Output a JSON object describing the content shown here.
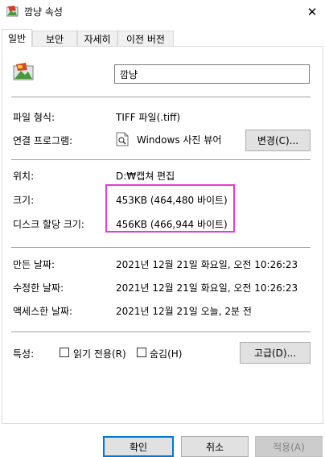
{
  "window": {
    "title": "깜냥 속성",
    "close_glyph": "✕"
  },
  "tabs": [
    {
      "label": "일반",
      "active": true
    },
    {
      "label": "보안",
      "active": false
    },
    {
      "label": "자세히",
      "active": false
    },
    {
      "label": "이전 버전",
      "active": false
    }
  ],
  "general": {
    "file_name": "깜냥",
    "file_type_label": "파일 형식:",
    "file_type_value": "TIFF 파일(.tiff)",
    "opens_with_label": "연결 프로그램:",
    "opens_with_value": "Windows 사진 뷰어",
    "change_button": "변경(C)...",
    "location_label": "위치:",
    "location_value": "D:₩캡쳐 편집",
    "size_label": "크기:",
    "size_value": "453KB (464,480 바이트)",
    "disk_size_label": "디스크 할당 크기:",
    "disk_size_value": "456KB (466,944 바이트)",
    "created_label": "만든 날짜:",
    "created_value": "2021년 12월 21일 화요일, 오전 10:26:23",
    "modified_label": "수정한 날짜:",
    "modified_value": "2021년 12월 21일 화요일, 오전 10:26:23",
    "accessed_label": "액세스한 날짜:",
    "accessed_value": "2021년 12월 21일 오늘, 2분 전",
    "attributes_label": "특성:",
    "readonly_label": "읽기 전용(R)",
    "hidden_label": "숨김(H)",
    "advanced_button": "고급(D)..."
  },
  "footer": {
    "ok": "확인",
    "cancel": "취소",
    "apply": "적용(A)"
  },
  "colors": {
    "highlight": "#e040d0",
    "accent": "#0078d7"
  },
  "icons": {
    "title": "image-file-icon",
    "file": "image-file-icon",
    "viewer": "photo-viewer-icon"
  }
}
